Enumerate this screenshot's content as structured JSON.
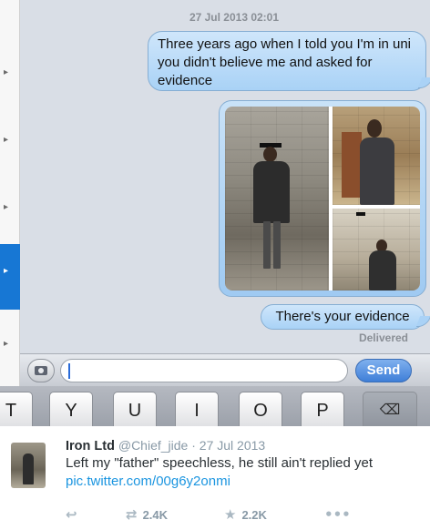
{
  "conversation": {
    "timestamp": "27 Jul 2013 02:01",
    "messages": [
      {
        "type": "text",
        "text": "Three years ago when I told you I'm in uni you didn't believe me and asked for evidence"
      },
      {
        "type": "photos",
        "description": "photo collage"
      },
      {
        "type": "text",
        "text": "There's your evidence"
      }
    ],
    "status": "Delivered"
  },
  "input_bar": {
    "camera_icon": "camera-icon",
    "message_value": "",
    "send_label": "Send"
  },
  "keyboard": {
    "keys": [
      "T",
      "Y",
      "U",
      "I",
      "O",
      "P"
    ],
    "delete_icon": "backspace-icon"
  },
  "tweet": {
    "display_name": "Iron Ltd",
    "handle": "@Chief_jide",
    "separator": "·",
    "date": "27 Jul 2013",
    "text": "Left my \"father\" speechless, he still ain't replied yet",
    "link": "pic.twitter.com/00g6y2onmi",
    "actions": {
      "reply_icon": "reply-icon",
      "retweet_icon": "retweet-icon",
      "retweets": "2.4K",
      "favorite_icon": "star-icon",
      "favorites": "2.2K",
      "more_icon": "more-icon"
    }
  }
}
